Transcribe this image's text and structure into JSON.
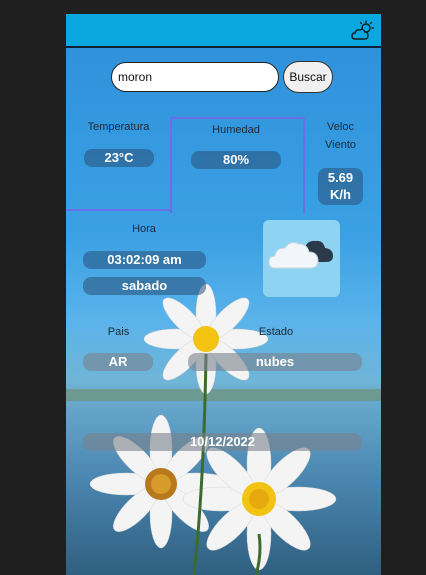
{
  "search": {
    "value": "moron",
    "button_label": "Buscar"
  },
  "stats": {
    "temperatura_label": "Temperatura",
    "temperatura_value": "23°C",
    "humedad_label": "Humedad",
    "humedad_value": "80%",
    "viento_label_line1": "Veloc",
    "viento_label_line2": "Viento",
    "viento_value_line1": "5.69",
    "viento_value_line2": "K/h"
  },
  "time": {
    "label": "Hora",
    "value": "03:02:09 am",
    "day": "sabado"
  },
  "location": {
    "pais_label": "Pais",
    "pais_value": "AR",
    "estado_label": "Estado",
    "estado_value": "nubes"
  },
  "date": "10/12/2022",
  "icons": {
    "header": "partly-cloudy-icon",
    "weather": "cloud-icon"
  },
  "colors": {
    "header": "#0aa8df",
    "accent_border": "#6a6ee8"
  }
}
